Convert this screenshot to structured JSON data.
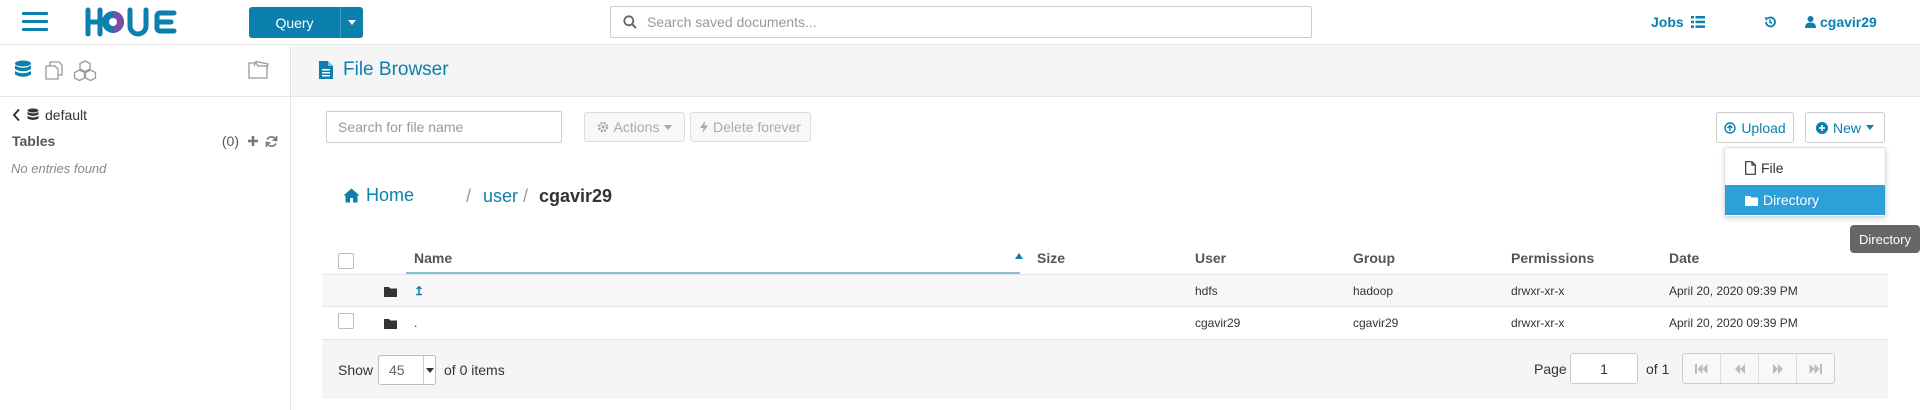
{
  "app": {
    "query_label": "Query",
    "search_placeholder": "Search saved documents...",
    "jobs_label": "Jobs",
    "username": "cgavir29",
    "accent_color": "#0b7fad"
  },
  "left_panel": {
    "tabs": [
      "database-icon",
      "documents-icon",
      "cubes-icon",
      "folder-icon"
    ],
    "database": "default",
    "tables_label": "Tables",
    "tables_count": "(0)",
    "empty_text": "No entries found"
  },
  "page": {
    "title": "File Browser"
  },
  "toolbar": {
    "search_placeholder": "Search for file name",
    "actions_label": "Actions",
    "delete_label": "Delete forever",
    "upload_label": "Upload",
    "new_label": "New"
  },
  "new_menu": {
    "items": [
      "File",
      "Directory"
    ],
    "active": "Directory",
    "tooltip": "Directory"
  },
  "breadcrumb": {
    "home": "Home",
    "sep": "/",
    "parts": [
      "user",
      "cgavir29"
    ]
  },
  "table": {
    "columns": [
      "Name",
      "Size",
      "User",
      "Group",
      "Permissions",
      "Date"
    ],
    "sort_column": "Name",
    "rows": [
      {
        "name": "↥",
        "size": "",
        "user": "hdfs",
        "group": "hadoop",
        "permissions": "drwxr-xr-x",
        "date": "April 20, 2020 09:39 PM"
      },
      {
        "name": ".",
        "size": "",
        "user": "cgavir29",
        "group": "cgavir29",
        "permissions": "drwxr-xr-x",
        "date": "April 20, 2020 09:39 PM"
      }
    ]
  },
  "pagination": {
    "show_label": "Show",
    "per_page": "45",
    "items_text": "of 0 items",
    "page_label": "Page",
    "page_value": "1",
    "page_of": "of 1"
  }
}
